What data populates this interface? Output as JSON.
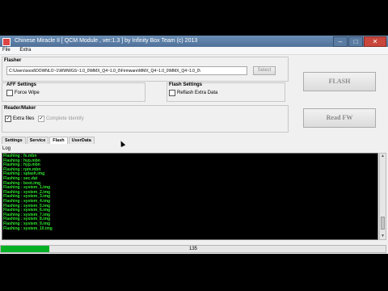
{
  "window": {
    "title": "Chinese Miracle II [ QCM Module , ver:1.3 ] by Infinity Box Team (c) 2013"
  },
  "menu": {
    "items": [
      "File",
      "Extra"
    ]
  },
  "flasher": {
    "group_label": "Flasher",
    "path_value": "C:\\Users\\sood\\DOWNLO~1\\WWWGS~1.0_0\\MMX_Q4~1.0_0\\Firmware\\MMX_Q4~1.0_0\\MMX_Q4~1.0_0\\",
    "select_label": "Select"
  },
  "aff_settings": {
    "label": "AFF Settings",
    "force_wipe_label": "Force Wipe",
    "force_wipe_checked": false
  },
  "flash_settings": {
    "label": "Flash Settings",
    "reflash_label": "Reflash Extra Data",
    "reflash_checked": false
  },
  "reader": {
    "label": "Reader/Maker",
    "extra_files_label": "Extra files",
    "extra_files_checked": true,
    "complete_identify_label": "Complete Identify",
    "complete_identify_checked": true
  },
  "buttons": {
    "flash": "FLASH",
    "read_fw": "Read FW"
  },
  "tabs": [
    "Settings",
    "Service",
    "Flash",
    "UserData"
  ],
  "active_tab": "Flash",
  "log": {
    "label": "Log",
    "lines": [
      "Flashing : fs.mbn",
      "Flashing : hyp.mbn",
      "Flashing : hyp.mbn",
      "Flashing : rpm.mbn",
      "Flashing : splash.img",
      "Flashing : sec.dat",
      "Flashing : boot.img",
      "Flashing : system_1.img",
      "Flashing : system_2.img",
      "Flashing : system_3.img",
      "Flashing : system_4.img",
      "Flashing : system_5.img",
      "Flashing : system_6.img",
      "Flashing : system_7.img",
      "Flashing : system_8.img",
      "Flashing : system_9.img",
      "Flashing : system_10.img"
    ]
  },
  "progress": {
    "value_text": "135",
    "fraction": 0.125
  },
  "colors": {
    "log_text": "#2ee62e",
    "progress_fill": "#06b025",
    "titlebar": "#5b7ea6"
  },
  "icons": {
    "app": "app-icon",
    "minimize": "minimize-icon",
    "maximize": "maximize-icon",
    "close": "close-icon"
  }
}
